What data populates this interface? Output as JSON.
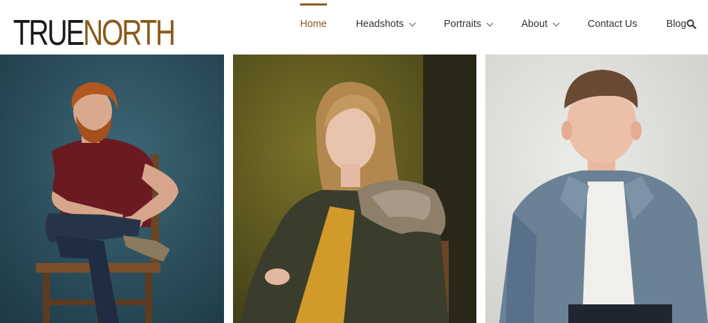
{
  "logo": {
    "part1": "TRUE",
    "part2": "NORTH"
  },
  "nav": {
    "items": [
      {
        "label": "Home",
        "active": true,
        "dropdown": false
      },
      {
        "label": "Headshots",
        "active": false,
        "dropdown": true
      },
      {
        "label": "Portraits",
        "active": false,
        "dropdown": true
      },
      {
        "label": "About",
        "active": false,
        "dropdown": true
      },
      {
        "label": "Contact Us",
        "active": false,
        "dropdown": false
      },
      {
        "label": "Blog",
        "active": false,
        "dropdown": false
      }
    ],
    "search_icon": "search-icon"
  },
  "colors": {
    "accent": "#8a5a1c",
    "text": "#333333"
  }
}
